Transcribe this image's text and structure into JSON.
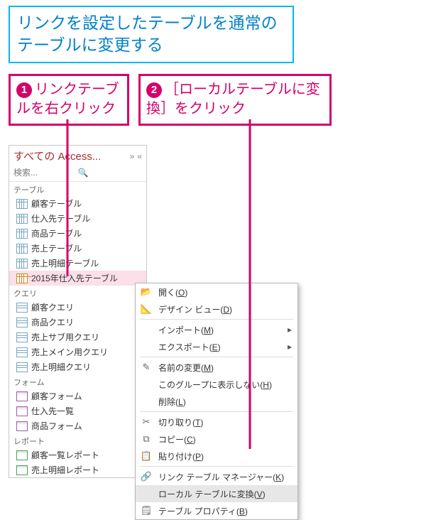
{
  "heading": "リンクを設定したテーブルを通常のテーブルに変更する",
  "step1": {
    "num": "❶",
    "text": "リンクテーブルを右クリック"
  },
  "step2": {
    "num": "❷",
    "text": "［ローカルテーブルに変換］をクリック"
  },
  "nav": {
    "title": "すべての Access...",
    "arrow_label": "»",
    "close_label": "«",
    "search_placeholder": "検索...",
    "sections": {
      "tables": "テーブル",
      "queries": "クエリ",
      "forms": "フォーム",
      "reports": "レポート"
    },
    "tables": [
      "顧客テーブル",
      "仕入先テーブル",
      "商品テーブル",
      "売上テーブル",
      "売上明細テーブル",
      "2015年仕入先テーブル"
    ],
    "queries": [
      "顧客クエリ",
      "商品クエリ",
      "売上サブ用クエリ",
      "売上メイン用クエリ",
      "売上明細クエリ"
    ],
    "forms": [
      "顧客フォーム",
      "仕入先一覧",
      "商品フォーム"
    ],
    "reports": [
      "顧客一覧レポート",
      "売上明細レポート"
    ],
    "selected_table_index": 5
  },
  "ctx": {
    "open": {
      "label": "開く(",
      "mn": "O",
      "after": ")"
    },
    "design": {
      "label": "デザイン ビュー(",
      "mn": "D",
      "after": ")"
    },
    "import": {
      "label": "インポート(",
      "mn": "M",
      "after": ")"
    },
    "export": {
      "label": "エクスポート(",
      "mn": "E",
      "after": ")"
    },
    "rename": {
      "label": "名前の変更(",
      "mn": "M",
      "after": ")"
    },
    "hide": {
      "label": "このグループに表示しない(",
      "mn": "H",
      "after": ")"
    },
    "delete": {
      "label": "削除(",
      "mn": "L",
      "after": ")"
    },
    "cut": {
      "label": "切り取り(",
      "mn": "T",
      "after": ")"
    },
    "copy": {
      "label": "コピー(",
      "mn": "C",
      "after": ")"
    },
    "paste": {
      "label": "貼り付け(",
      "mn": "P",
      "after": ")"
    },
    "linkmgr": {
      "label": "リンク テーブル マネージャー(",
      "mn": "K",
      "after": ")"
    },
    "convert": {
      "label": "ローカル テーブルに変換(",
      "mn": "V",
      "after": ")"
    },
    "props": {
      "label": "テーブル プロパティ(",
      "mn": "B",
      "after": ")"
    },
    "submenu_marker": "▸"
  }
}
